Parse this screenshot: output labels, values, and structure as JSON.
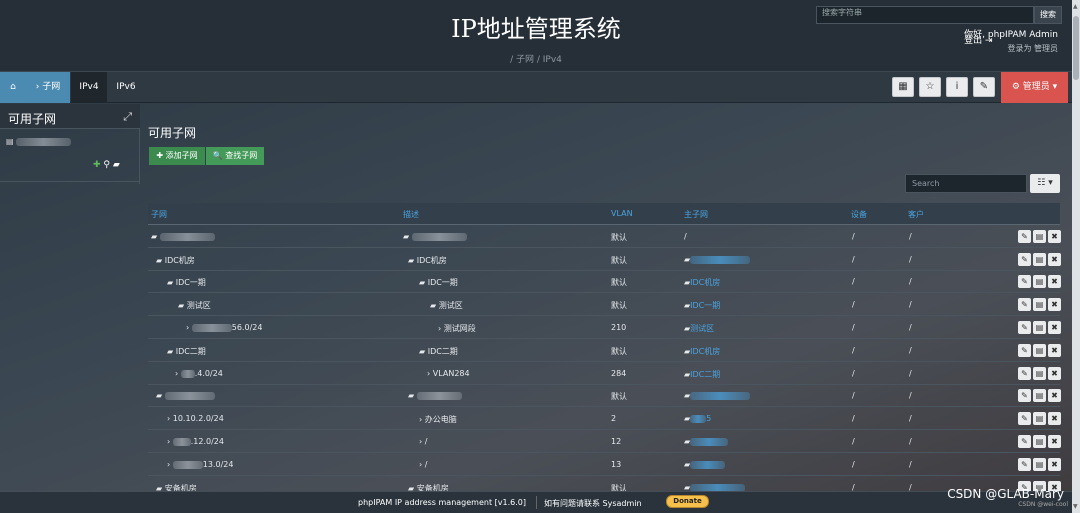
{
  "header": {
    "title": "IP地址管理系统",
    "breadcrumb": "/ 子网 / IPv4",
    "search_placeholder": "搜索字符串",
    "search_button": "搜索",
    "greeting": "你好, phpIPAM Admin",
    "logged_as": "登录为 管理员",
    "logout": "登出 ⇥"
  },
  "nav": {
    "home_icon": "home-icon",
    "crumb": "› 子网",
    "tabs": [
      "IPv4",
      "IPv6"
    ],
    "admin": "⚙ 管理员 ▾"
  },
  "sidebar": {
    "title": "可用子网"
  },
  "main": {
    "title": "可用子网",
    "add": "✚ 添加子网",
    "find": "🔍 查找子网",
    "search_placeholder": "Search",
    "col_button": "☷ ▾"
  },
  "table": {
    "headers": [
      "子网",
      "描述",
      "VLAN",
      "主子网",
      "设备",
      "客户"
    ],
    "rows": [
      {
        "subnet": "",
        "desc": "",
        "vlan": "默认",
        "master": "/",
        "device": "/",
        "customer": "/"
      },
      {
        "subnet": "IDC机房",
        "desc": "IDC机房",
        "vlan": "默认",
        "master": "",
        "device": "/",
        "customer": "/"
      },
      {
        "subnet": "IDC一期",
        "desc": "IDC一期",
        "vlan": "默认",
        "master": "IDC机房",
        "device": "/",
        "customer": "/"
      },
      {
        "subnet": "测试区",
        "desc": "测试区",
        "vlan": "默认",
        "master": "IDC一期",
        "device": "/",
        "customer": "/"
      },
      {
        "subnet": "56.0/24",
        "desc": "测试网段",
        "vlan": "210",
        "master": "测试区",
        "device": "/",
        "customer": "/"
      },
      {
        "subnet": "IDC二期",
        "desc": "IDC二期",
        "vlan": "默认",
        "master": "IDC机房",
        "device": "/",
        "customer": "/"
      },
      {
        "subnet": ".4.0/24",
        "desc": "VLAN284",
        "vlan": "284",
        "master": "IDC二期",
        "device": "/",
        "customer": "/"
      },
      {
        "subnet": "",
        "desc": "",
        "vlan": "默认",
        "master": "",
        "device": "/",
        "customer": "/"
      },
      {
        "subnet": "10.10.2.0/24",
        "desc": "办公电脑",
        "vlan": "2",
        "master": "5",
        "device": "/",
        "customer": "/"
      },
      {
        "subnet": ".12.0/24",
        "desc": "/",
        "vlan": "12",
        "master": "",
        "device": "/",
        "customer": "/"
      },
      {
        "subnet": "13.0/24",
        "desc": "/",
        "vlan": "13",
        "master": "",
        "device": "/",
        "customer": "/"
      },
      {
        "subnet": "安备机房",
        "desc": "安备机房",
        "vlan": "默认",
        "master": "",
        "device": "/",
        "customer": "/"
      }
    ]
  },
  "footer": {
    "text": "phpIPAM IP address management [v1.6.0]",
    "contact": "如有问题请联系 Sysadmin",
    "donate": "Donate"
  },
  "watermark": "CSDN @GLAB-Mary",
  "watermark2": "CSDN @wei-cool",
  "colors": {
    "accent": "#4aa3df",
    "admin": "#d9534f",
    "green": "#3b8b4f"
  }
}
